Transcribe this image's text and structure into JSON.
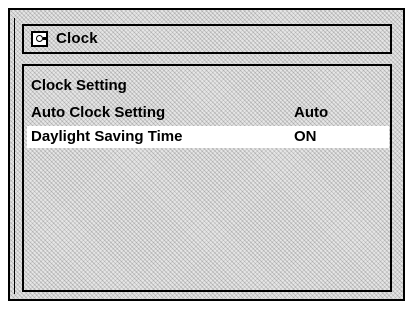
{
  "window": {
    "title": "Clock",
    "icon": "clock-icon"
  },
  "menu": {
    "heading": "Clock Setting",
    "items": [
      {
        "label": "Auto Clock Setting",
        "value": "Auto",
        "selected": false
      },
      {
        "label": "Daylight Saving Time",
        "value": "ON",
        "selected": true
      }
    ]
  },
  "colors": {
    "selected_row": "#ffffff",
    "text": "#000000"
  }
}
